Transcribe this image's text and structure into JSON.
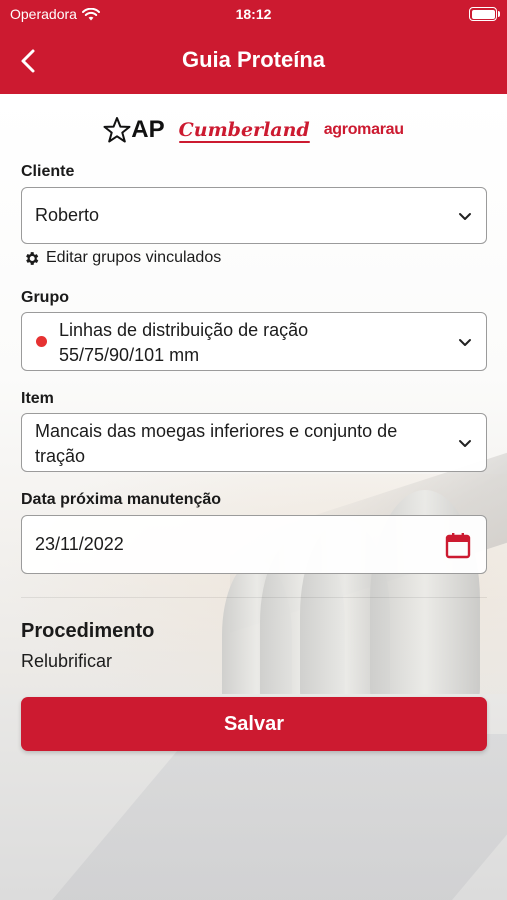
{
  "status_bar": {
    "carrier": "Operadora",
    "time": "18:12"
  },
  "header": {
    "title": "Guia Proteína",
    "back_icon": "chevron-left-icon"
  },
  "logos": {
    "ap": "AP",
    "cumberland": "Cumberland",
    "agromarau": "agromarau"
  },
  "form": {
    "cliente": {
      "label": "Cliente",
      "value": "Roberto"
    },
    "edit_groups": {
      "label": "Editar grupos vinculados",
      "icon": "gear-icon"
    },
    "grupo": {
      "label": "Grupo",
      "value_line1": "Linhas de distribuição de ração",
      "value_line2": "55/75/90/101 mm",
      "dot_color": "#e63232"
    },
    "item": {
      "label": "Item",
      "value_line1": "Mancais das moegas inferiores e conjunto de",
      "value_line2": "tração"
    },
    "data": {
      "label": "Data próxima manutenção",
      "value": "23/11/2022",
      "icon": "calendar-icon"
    }
  },
  "procedimento": {
    "title": "Procedimento",
    "value": "Relubrificar"
  },
  "actions": {
    "save_label": "Salvar"
  },
  "colors": {
    "brand": "#cc1a30",
    "text": "#1c1c1c"
  }
}
